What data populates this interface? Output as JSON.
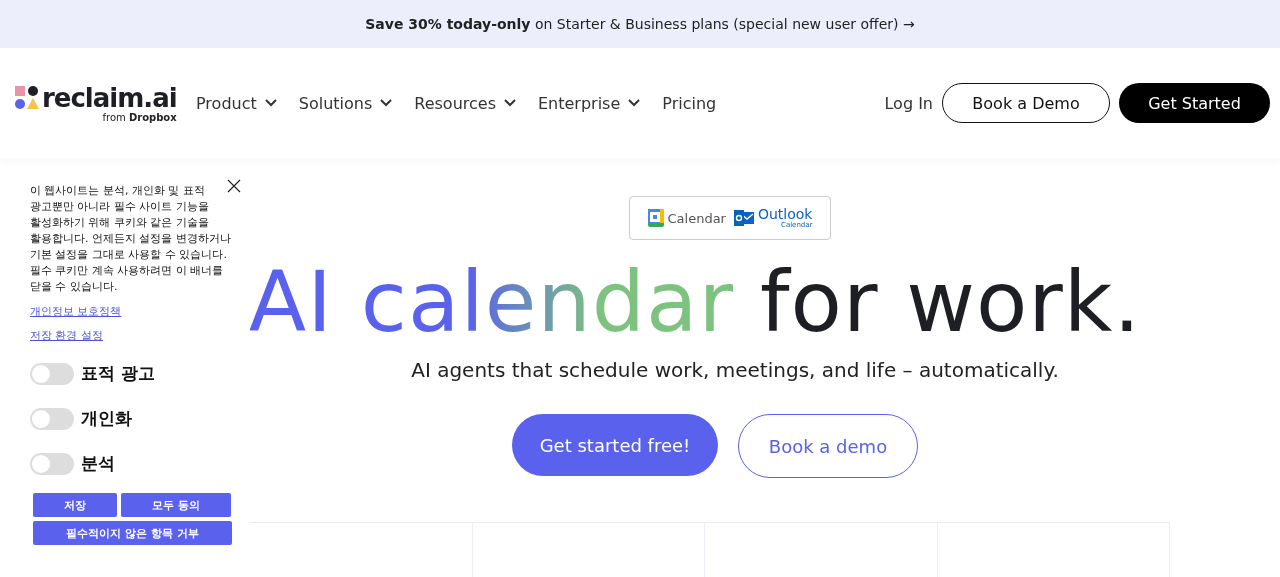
{
  "promo_bar": {
    "bold": "Save 30% today-only",
    "text": "on Starter & Business plans (special new user offer) →"
  },
  "header": {
    "logo": {
      "name": "reclaim.ai",
      "byline_prefix": "from",
      "byline_brand": "Dropbox"
    },
    "nav": [
      {
        "label": "Product",
        "dropdown": true
      },
      {
        "label": "Solutions",
        "dropdown": true
      },
      {
        "label": "Resources",
        "dropdown": true
      },
      {
        "label": "Enterprise",
        "dropdown": true
      },
      {
        "label": "Pricing",
        "dropdown": false
      }
    ],
    "login": "Log In",
    "demo_button": "Book a Demo",
    "start_button": "Get Started"
  },
  "hero": {
    "integrations": [
      {
        "kind": "google",
        "label": "Calendar"
      },
      {
        "kind": "outlook",
        "label": "Outlook",
        "sub": "Calendar"
      }
    ],
    "heading_gradient": "AI calendar",
    "heading_plain": "for work.",
    "subtitle": "AI agents that schedule work, meetings, and life – automatically.",
    "primary_button": "Get started free!",
    "secondary_button": "Book a demo"
  },
  "cookie_banner": {
    "text": "이 웹사이트는 분석, 개인화 및 표적 광고뿐만 아니라 필수 사이트 기능을 활성화하기 위해 쿠키와 같은 기술을 활용합니다. 언제든지 설정을 변경하거나 기본 설정을 그대로 사용할 수 있습니다. 필수 쿠키만 계속 사용하려면 이 배너를 닫을 수 있습니다.",
    "links": [
      "개인정보 보호정책",
      "저장 환경 설정"
    ],
    "toggles": [
      {
        "label": "표적 광고",
        "checked": false
      },
      {
        "label": "개인화",
        "checked": false
      },
      {
        "label": "분석",
        "checked": false
      }
    ],
    "buttons": [
      "저장",
      "모두 동의",
      "필수적이지 않은 항목 거부"
    ]
  }
}
